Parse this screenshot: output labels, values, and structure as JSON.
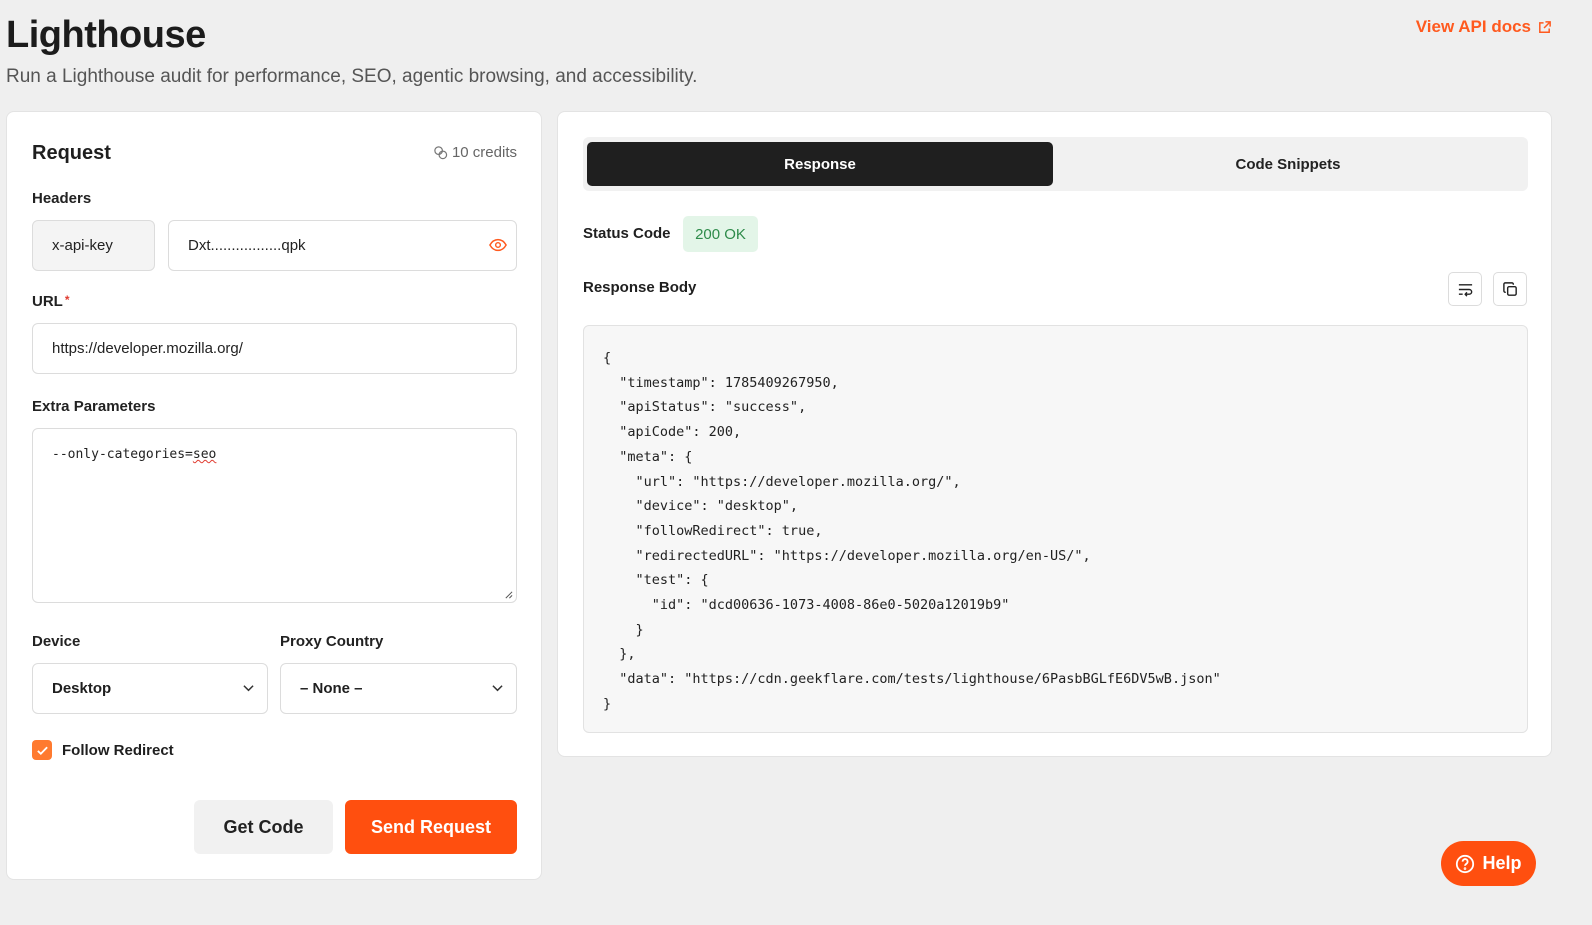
{
  "header": {
    "title": "Lighthouse",
    "subtitle": "Run a Lighthouse audit for performance, SEO, agentic browsing, and accessibility.",
    "api_docs_label": "View API docs"
  },
  "request": {
    "title": "Request",
    "credits": "10 credits",
    "headers_label": "Headers",
    "header_key": "x-api-key",
    "header_value": "Dxt.................qpk",
    "url_label": "URL",
    "url_required_mark": "*",
    "url_value": "https://developer.mozilla.org/",
    "extra_label": "Extra Parameters",
    "extra_value_prefix": "--only-categories=",
    "extra_value_suffix": "seo",
    "device_label": "Device",
    "device_value": "Desktop",
    "proxy_label": "Proxy Country",
    "proxy_value": "– None –",
    "follow_redirect_label": "Follow Redirect",
    "follow_redirect_checked": true,
    "get_code_label": "Get Code",
    "send_label": "Send Request"
  },
  "response": {
    "tabs": [
      {
        "label": "Response",
        "active": true
      },
      {
        "label": "Code Snippets",
        "active": false
      }
    ],
    "status_label": "Status Code",
    "status_value": "200 OK",
    "body_label": "Response Body",
    "body": "{\n  \"timestamp\": 1785409267950,\n  \"apiStatus\": \"success\",\n  \"apiCode\": 200,\n  \"meta\": {\n    \"url\": \"https://developer.mozilla.org/\",\n    \"device\": \"desktop\",\n    \"followRedirect\": true,\n    \"redirectedURL\": \"https://developer.mozilla.org/en-US/\",\n    \"test\": {\n      \"id\": \"dcd00636-1073-4008-86e0-5020a12019b9\"\n    }\n  },\n  \"data\": \"https://cdn.geekflare.com/tests/lighthouse/6PasbBGLfE6DV5wB.json\"\n}"
  },
  "help_label": "Help",
  "colors": {
    "accent": "#ff4f0f",
    "status_ok_bg": "#e3f5e8",
    "status_ok_text": "#2e8b4a",
    "tab_active_bg": "#1f1f1f"
  }
}
